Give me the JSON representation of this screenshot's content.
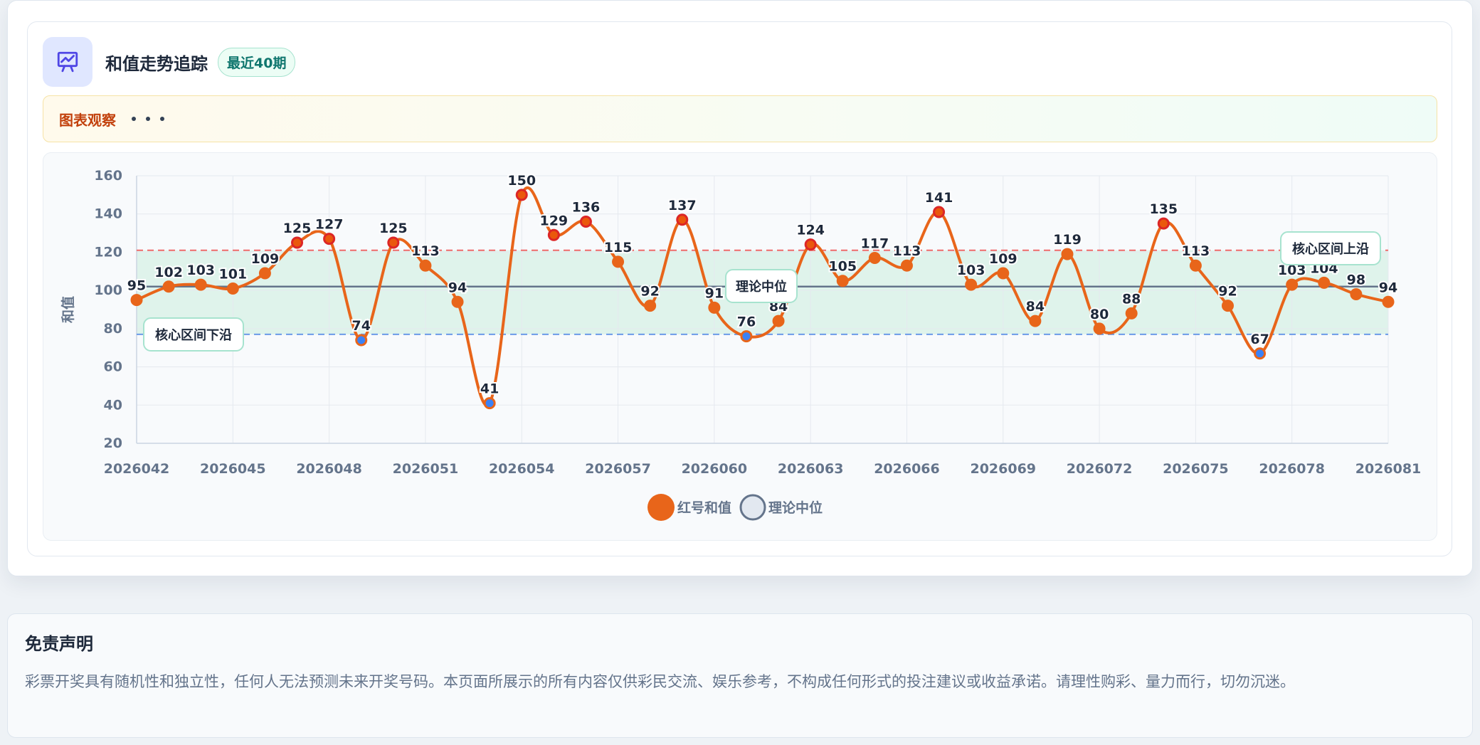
{
  "header": {
    "title": "和值走势追踪",
    "badge": "最近40期"
  },
  "observation": {
    "label": "图表观察"
  },
  "chart_data": {
    "type": "line",
    "ylabel": "和值",
    "ylim": [
      20,
      160
    ],
    "yticks": [
      20,
      40,
      60,
      80,
      100,
      120,
      140,
      160
    ],
    "x": [
      "2026042",
      "2026043",
      "2026044",
      "2026045",
      "2026046",
      "2026047",
      "2026048",
      "2026049",
      "2026050",
      "2026051",
      "2026052",
      "2026053",
      "2026054",
      "2026055",
      "2026056",
      "2026057",
      "2026058",
      "2026059",
      "2026060",
      "2026061",
      "2026062",
      "2026063",
      "2026064",
      "2026065",
      "2026066",
      "2026067",
      "2026068",
      "2026069",
      "2026070",
      "2026071",
      "2026072",
      "2026073",
      "2026074",
      "2026075",
      "2026076",
      "2026077",
      "2026078",
      "2026079",
      "2026080",
      "2026081"
    ],
    "xticks": [
      "2026042",
      "2026045",
      "2026048",
      "2026051",
      "2026054",
      "2026057",
      "2026060",
      "2026063",
      "2026066",
      "2026069",
      "2026072",
      "2026075",
      "2026078",
      "2026081"
    ],
    "series": [
      {
        "name": "红号和值",
        "color": "#e8651a",
        "values": [
          95,
          102,
          103,
          101,
          109,
          125,
          127,
          74,
          125,
          113,
          94,
          41,
          150,
          129,
          136,
          115,
          92,
          137,
          91,
          76,
          84,
          124,
          105,
          117,
          113,
          141,
          103,
          109,
          84,
          119,
          80,
          88,
          135,
          113,
          92,
          67,
          103,
          104,
          98,
          94
        ]
      },
      {
        "name": "理论中位",
        "color": "#64748b",
        "value": 102
      }
    ],
    "band": {
      "low": 77,
      "high": 121,
      "color": "#d7f0e6"
    },
    "reference_lines": [
      {
        "label": "核心区间上沿",
        "value": 121,
        "color": "#ef6b6b"
      },
      {
        "label": "核心区间下沿",
        "value": 77,
        "color": "#6b9ae8"
      }
    ],
    "annotations": {
      "median_label": "理论中位",
      "upper_label": "核心区间上沿",
      "lower_label": "核心区间下沿"
    },
    "legend": [
      "红号和值",
      "理论中位"
    ],
    "legend_position": "bottom",
    "grid": true
  },
  "disclaimer": {
    "title": "免责声明",
    "text": "彩票开奖具有随机性和独立性，任何人无法预测未来开奖号码。本页面所展示的所有内容仅供彩民交流、娱乐参考，不构成任何形式的投注建议或收益承诺。请理性购彩、量力而行，切勿沉迷。"
  }
}
